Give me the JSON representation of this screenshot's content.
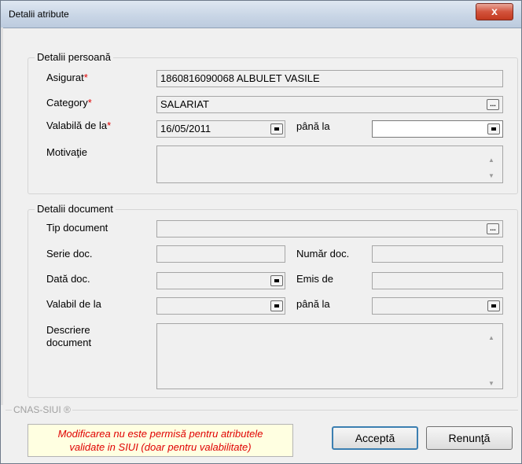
{
  "window": {
    "title": "Detalii atribute",
    "close_label": "x"
  },
  "personal_group": {
    "legend": "Detalii persoană",
    "insured_label": "Asigurat",
    "insured_value": "1860816090068 ALBULET VASILE",
    "category_label": "Category",
    "category_value": "SALARIAT",
    "valid_from_label": "Valabilă de la",
    "valid_from_value": "16/05/2011",
    "until_label": "până la",
    "until_value": "",
    "motivation_label": "Motivaţie",
    "motivation_value": "",
    "required_mark": "*",
    "ellipsis": "...",
    "calendar_icon": "calendar-icon"
  },
  "document_group": {
    "legend": "Detalii document",
    "doc_type_label": "Tip document",
    "doc_type_value": "",
    "series_label": "Serie doc.",
    "series_value": "",
    "number_label": "Număr doc.",
    "number_value": "",
    "date_label": "Dată doc.",
    "date_value": "",
    "issued_by_label": "Emis de",
    "issued_by_value": "",
    "valid_from_label": "Valabil de la",
    "valid_from_value": "",
    "until_label": "până la",
    "until_value": "",
    "description_label_line1": "Descriere",
    "description_label_line2": "document",
    "description_value": "",
    "ellipsis": "..."
  },
  "footer": {
    "group_label": "CNAS-SIUI ®",
    "message_line1": "Modificarea nu este permisă pentru atributele",
    "message_line2": "validate in SIUI (doar pentru valabilitate)",
    "accept_label": "Acceptă",
    "cancel_label": "Renunţă"
  }
}
